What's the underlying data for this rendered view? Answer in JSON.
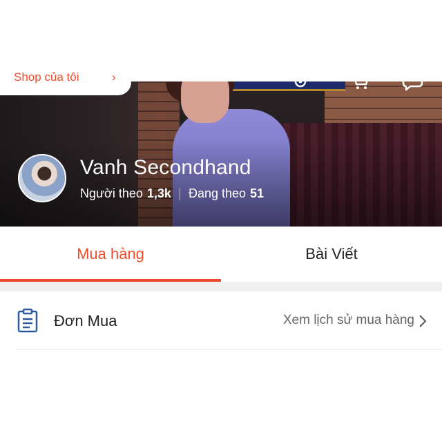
{
  "header": {
    "shop_button_label": "Shop của tôi",
    "icons": [
      "settings-icon",
      "cart-icon",
      "chat-icon"
    ]
  },
  "profile": {
    "name": "Vanh Secondhand",
    "followers_label": "Người theo",
    "followers_count": "1,3k",
    "following_label": "Đang theo",
    "following_count": "51"
  },
  "tabs": [
    {
      "label": "Mua hàng",
      "active": true
    },
    {
      "label": "Bài Viết",
      "active": false
    }
  ],
  "orders": {
    "label": "Đơn Mua",
    "link_label": "Xem lịch sử mua hàng"
  },
  "colors": {
    "accent": "#ee4d2d",
    "icon_blue": "#2d5b9a"
  }
}
